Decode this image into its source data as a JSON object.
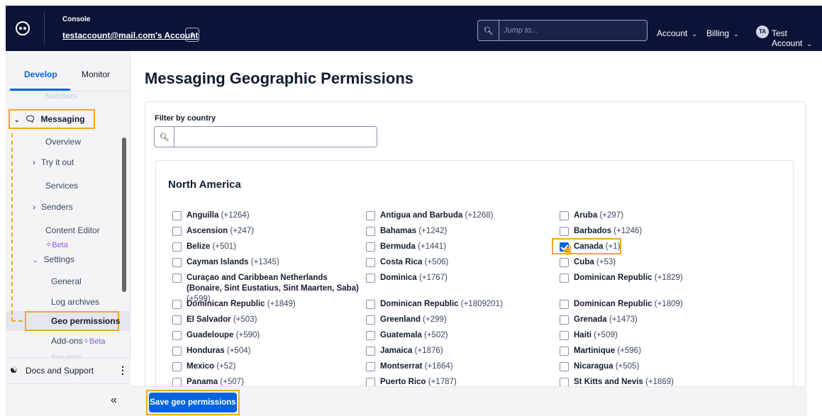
{
  "topbar": {
    "console_label": "Console",
    "account_name": "testaccount@mail.com's Account",
    "search_placeholder": "Jump to...",
    "menu_account": "Account",
    "menu_billing": "Billing",
    "user_initials": "TA",
    "user_name": "Test Account"
  },
  "sidebar": {
    "tabs": {
      "develop": "Develop",
      "monitor": "Monitor"
    },
    "numbers": "Numbers",
    "messaging": "Messaging",
    "items": {
      "overview": "Overview",
      "try_it_out": "Try it out",
      "services": "Services",
      "senders": "Senders",
      "content_editor": "Content Editor",
      "beta": "Beta",
      "settings": "Settings",
      "general": "General",
      "log_archives": "Log archives",
      "geo_permissions": "Geo permissions",
      "add_ons": "Add-ons",
      "add_ons_beta": "Beta",
      "regulatory": "Regulatory"
    },
    "docs_support": "Docs and Support",
    "collapse": "«"
  },
  "main": {
    "title": "Messaging Geographic Permissions",
    "filter_label": "Filter by country",
    "filter_value": "",
    "region": "North America",
    "countries": [
      {
        "name": "Anguilla",
        "code": "(+1264)",
        "checked": false
      },
      {
        "name": "Antigua and Barbuda",
        "code": "(+1268)",
        "checked": false
      },
      {
        "name": "Aruba",
        "code": "(+297)",
        "checked": false
      },
      {
        "name": "Ascension",
        "code": "(+247)",
        "checked": false
      },
      {
        "name": "Bahamas",
        "code": "(+1242)",
        "checked": false
      },
      {
        "name": "Barbados",
        "code": "(+1246)",
        "checked": false
      },
      {
        "name": "Belize",
        "code": "(+501)",
        "checked": false
      },
      {
        "name": "Bermuda",
        "code": "(+1441)",
        "checked": false
      },
      {
        "name": "Canada",
        "code": "(+1)",
        "checked": true
      },
      {
        "name": "Cayman Islands",
        "code": "(+1345)",
        "checked": false
      },
      {
        "name": "Costa Rica",
        "code": "(+506)",
        "checked": false
      },
      {
        "name": "Cuba",
        "code": "(+53)",
        "checked": false
      },
      {
        "name": "Curaçao and Caribbean Netherlands (Bonaire, Sint Eustatius, Sint Maarten, Saba)",
        "code": "(+599)",
        "checked": false
      },
      {
        "name": "Dominica",
        "code": "(+1767)",
        "checked": false
      },
      {
        "name": "Dominican Republic",
        "code": "(+1829)",
        "checked": false
      },
      {
        "name": "Dominican Republic",
        "code": "(+1849)",
        "checked": false
      },
      {
        "name": "Dominican Republic",
        "code": "(+1809201)",
        "checked": false
      },
      {
        "name": "Dominican Republic",
        "code": "(+1809)",
        "checked": false
      },
      {
        "name": "El Salvador",
        "code": "(+503)",
        "checked": false
      },
      {
        "name": "Greenland",
        "code": "(+299)",
        "checked": false
      },
      {
        "name": "Grenada",
        "code": "(+1473)",
        "checked": false
      },
      {
        "name": "Guadeloupe",
        "code": "(+590)",
        "checked": false
      },
      {
        "name": "Guatemala",
        "code": "(+502)",
        "checked": false
      },
      {
        "name": "Haiti",
        "code": "(+509)",
        "checked": false
      },
      {
        "name": "Honduras",
        "code": "(+504)",
        "checked": false
      },
      {
        "name": "Jamaica",
        "code": "(+1876)",
        "checked": false
      },
      {
        "name": "Martinique",
        "code": "(+596)",
        "checked": false
      },
      {
        "name": "Mexico",
        "code": "(+52)",
        "checked": false
      },
      {
        "name": "Montserrat",
        "code": "(+1664)",
        "checked": false
      },
      {
        "name": "Nicaragua",
        "code": "(+505)",
        "checked": false
      },
      {
        "name": "Panama",
        "code": "(+507)",
        "checked": false
      },
      {
        "name": "Puerto Rico",
        "code": "(+1787)",
        "checked": false
      },
      {
        "name": "St Kitts and Nevis",
        "code": "(+1869)",
        "checked": false
      }
    ],
    "save_button": "Save geo permissions"
  },
  "colors": {
    "topbar_bg": "#0b1336",
    "accent": "#0263e0",
    "highlight": "#f5a623"
  }
}
